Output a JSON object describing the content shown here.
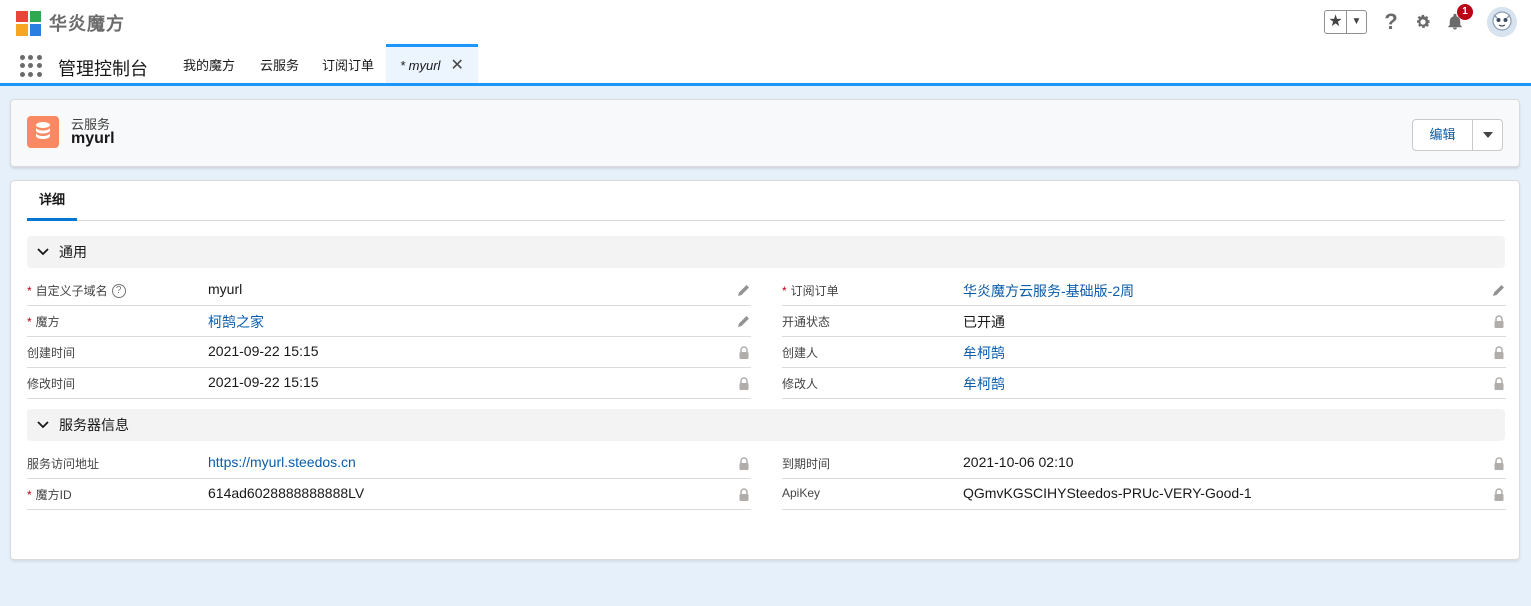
{
  "brand": {
    "name": "华炎魔方",
    "logo_colors": [
      "#e8463b",
      "#f6a623",
      "#2fa84f",
      "#2a7de1"
    ]
  },
  "header": {
    "notification_count": "1",
    "icons": [
      "star-icon",
      "chevron-down-icon",
      "help-icon",
      "gear-icon",
      "bell-icon",
      "avatar"
    ]
  },
  "nav": {
    "app_name": "管理控制台",
    "tabs": [
      {
        "label": "我的魔方"
      },
      {
        "label": "云服务"
      },
      {
        "label": "订阅订单"
      },
      {
        "label": "* myurl",
        "active": true
      }
    ]
  },
  "record": {
    "type": "云服务",
    "name": "myurl",
    "edit_label": "编辑",
    "icon": "database-icon",
    "icon_color": "#f88962"
  },
  "detail": {
    "tab_label": "详细",
    "sections": [
      {
        "title": "通用",
        "left": [
          {
            "label": "自定义子域名",
            "required": true,
            "help": true,
            "value": "myurl",
            "link": false,
            "action": "edit"
          },
          {
            "label": "魔方",
            "required": true,
            "value": "柯鹄之家",
            "link": true,
            "action": "edit"
          },
          {
            "label": "创建时间",
            "value": "2021-09-22 15:15",
            "link": false,
            "action": "lock"
          },
          {
            "label": "修改时间",
            "value": "2021-09-22 15:15",
            "link": false,
            "action": "lock"
          }
        ],
        "right": [
          {
            "label": "订阅订单",
            "required": true,
            "value": "华炎魔方云服务-基础版-2周",
            "link": true,
            "action": "edit"
          },
          {
            "label": "开通状态",
            "value": "已开通",
            "link": false,
            "action": "lock"
          },
          {
            "label": "创建人",
            "value": "牟柯鹄",
            "link": true,
            "action": "lock"
          },
          {
            "label": "修改人",
            "value": "牟柯鹄",
            "link": true,
            "action": "lock"
          }
        ]
      },
      {
        "title": "服务器信息",
        "left": [
          {
            "label": "服务访问地址",
            "value": "https://myurl.steedos.cn",
            "link": true,
            "action": "lock"
          },
          {
            "label": "魔方ID",
            "required": true,
            "value": "614ad6028888888888LV",
            "link": false,
            "action": "lock"
          }
        ],
        "right": [
          {
            "label": "到期时间",
            "value": "2021-10-06 02:10",
            "link": false,
            "action": "lock"
          },
          {
            "label": "ApiKey",
            "value": "QGmvKGSCIHYSteedos-PRUc-VERY-Good-1",
            "link": false,
            "action": "lock"
          }
        ]
      }
    ]
  },
  "colors": {
    "accent": "#1b96ff",
    "link": "#0b5cab",
    "required": "#ba0517",
    "background": "#e6f0fb"
  }
}
